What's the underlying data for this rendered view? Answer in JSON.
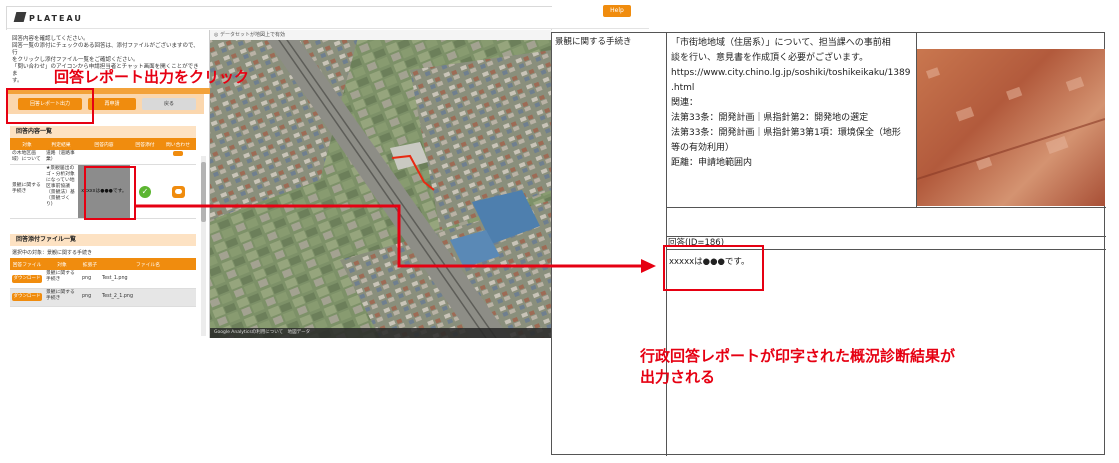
{
  "app": {
    "logo": "PLATEAU",
    "help_label": "Help",
    "notice_lines": [
      "回答内容を確認してください。",
      "回答一覧の添付にチェックのある回答は、添付ファイルがございますので、行",
      "をクリックし添付ファイル一覧をご確認ください。",
      "「問い合わせ」のアイコンから申請担当者とチャット画面を開くことができま",
      "す。"
    ],
    "buttons": {
      "report_output": "回答レポート出力",
      "reapply": "再申請",
      "back": "戻る"
    },
    "answers_section": {
      "title": "回答内容一覧",
      "columns": [
        "対象",
        "判定結果",
        "回答内容",
        "回答添付",
        "問い合わせ"
      ],
      "rows": [
        {
          "target": "の木地区画域）について",
          "result": "道路（道路事業）",
          "answer": "",
          "attach": false,
          "inquiry": true
        },
        {
          "target": "景観に関する手続き",
          "result": "★景観届出のゴ・分析対象になってい地区事前協議（景観法）基（景観づくり)",
          "answer": "xxxxxは●●●です。",
          "attach": true,
          "inquiry": true
        }
      ]
    },
    "files_section": {
      "title": "回答添付ファイル一覧",
      "subtitle": "選択中の対象：景観に関する手続き",
      "columns": [
        "回答ファイル",
        "対象",
        "拡張子",
        "ファイル名"
      ],
      "rows": [
        {
          "action": "ダウンロード",
          "target": "景観に関する手続き",
          "ext": "png",
          "name": "Test_1.png"
        },
        {
          "action": "ダウンロード",
          "target": "景観に関する手続き",
          "ext": "png",
          "name": "Test_2_1.png"
        }
      ]
    },
    "map": {
      "toolbar_text": "データセットが地図上で有効",
      "footer_text": "Google Analyticsの利用について　地図データ"
    }
  },
  "annotations": {
    "click_instruction": "回答レポート出力をクリック",
    "result_note_line1": "行政回答レポートが印字された概況診断結果が",
    "result_note_line2": "出力される",
    "red_color": "#e60012"
  },
  "document": {
    "row_label": "景観に関する手続き",
    "content_lines": [
      "「市街地地域（住居系）」について、担当課への事前相",
      "談を行い、意見書を作成頂く必要がございます。",
      "https://www.city.chino.lg.jp/soshiki/toshikeikaku/1389",
      ".html",
      "関連：",
      "法第33条：開発計画｜県指針第2：開発地の選定",
      "法第33条：開発計画｜県指針第3第1項：環境保全（地形",
      "等の有効利用）",
      "距離：申請地範囲内"
    ],
    "answer_header": "回答(ID=186)",
    "answer_text": "xxxxxは●●●です。"
  },
  "colors": {
    "accent_orange": "#f08c0e",
    "section_bg": "#fde2c3"
  }
}
